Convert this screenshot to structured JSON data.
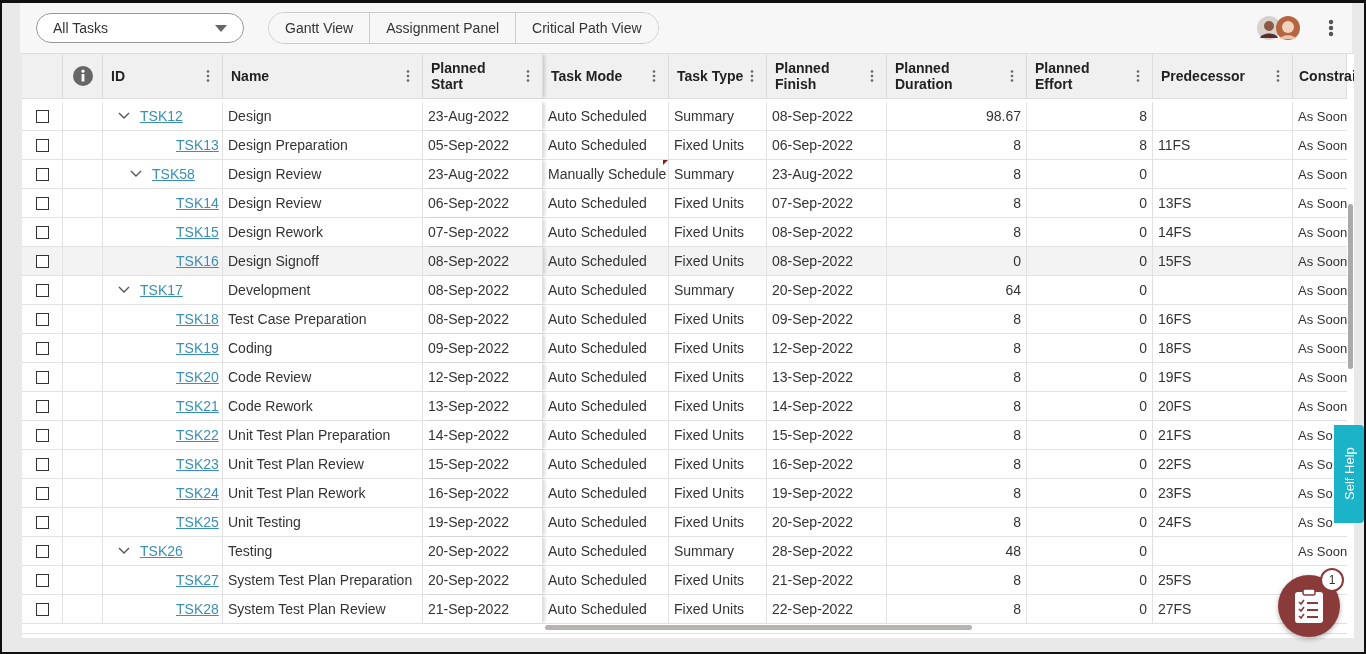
{
  "toolbar": {
    "filter": {
      "value": "All Tasks"
    },
    "views": [
      {
        "label": "Gantt View",
        "selected": false
      },
      {
        "label": "Assignment Panel",
        "selected": false
      },
      {
        "label": "Critical Path View",
        "selected": false
      }
    ]
  },
  "table": {
    "columns": [
      "ID",
      "Name",
      "Planned Start",
      "Task Mode",
      "Task Type",
      "Planned Finish",
      "Planned Duration",
      "Planned Effort",
      "Predecessor",
      "Constrai"
    ],
    "rows": [
      {
        "id": "TSK12",
        "name": "Design",
        "start": "23-Aug-2022",
        "mode": "Auto Scheduled",
        "type": "Summary",
        "finish": "08-Sep-2022",
        "duration": "98.67",
        "effort": "8",
        "constraint": "As Soon",
        "checked": false,
        "highlighted": false,
        "expanded": true,
        "children": [
          {
            "id": "TSK13",
            "name": "Design Preparation",
            "start": "05-Sep-2022",
            "mode": "Auto Scheduled",
            "type": "Fixed Units",
            "finish": "06-Sep-2022",
            "duration": "8",
            "effort": "8",
            "predecessor": "11FS",
            "constraint": "As Soon",
            "checked": false,
            "highlighted": false
          },
          {
            "id": "TSK58",
            "name": "Design Review",
            "start": "23-Aug-2022",
            "mode": "Manually Schedule",
            "type": "Summary",
            "finish": "23-Aug-2022",
            "duration": "8",
            "effort": "0",
            "constraint": "As Soon",
            "checked": false,
            "highlighted": false,
            "expanded": true,
            "flagged": true,
            "children": [
              {
                "id": "TSK14",
                "name": "Design Review",
                "start": "06-Sep-2022",
                "mode": "Auto Scheduled",
                "type": "Fixed Units",
                "finish": "07-Sep-2022",
                "duration": "8",
                "effort": "0",
                "predecessor": "13FS",
                "constraint": "As Soon",
                "checked": false,
                "highlighted": false
              },
              {
                "id": "TSK15",
                "name": "Design Rework",
                "start": "07-Sep-2022",
                "mode": "Auto Scheduled",
                "type": "Fixed Units",
                "finish": "08-Sep-2022",
                "duration": "8",
                "effort": "0",
                "predecessor": "14FS",
                "constraint": "As Soon",
                "checked": false,
                "highlighted": false
              },
              {
                "id": "TSK16",
                "name": "Design Signoff",
                "start": "08-Sep-2022",
                "mode": "Auto Scheduled",
                "type": "Fixed Units",
                "finish": "08-Sep-2022",
                "duration": "0",
                "effort": "0",
                "predecessor": "15FS",
                "constraint": "As Soon",
                "checked": false,
                "highlighted": true
              }
            ]
          }
        ]
      },
      {
        "id": "TSK17",
        "name": "Development",
        "start": "08-Sep-2022",
        "mode": "Auto Scheduled",
        "type": "Summary",
        "finish": "20-Sep-2022",
        "duration": "64",
        "effort": "0",
        "constraint": "As Soon",
        "checked": false,
        "highlighted": false,
        "expanded": true,
        "children": [
          {
            "id": "TSK18",
            "name": "Test Case Preparation",
            "start": "08-Sep-2022",
            "mode": "Auto Scheduled",
            "type": "Fixed Units",
            "finish": "09-Sep-2022",
            "duration": "8",
            "effort": "0",
            "predecessor": "16FS",
            "constraint": "As Soon",
            "checked": false,
            "highlighted": false
          },
          {
            "id": "TSK19",
            "name": "Coding",
            "start": "09-Sep-2022",
            "mode": "Auto Scheduled",
            "type": "Fixed Units",
            "finish": "12-Sep-2022",
            "duration": "8",
            "effort": "0",
            "predecessor": "18FS",
            "constraint": "As Soon",
            "checked": false,
            "highlighted": false
          },
          {
            "id": "TSK20",
            "name": "Code Review",
            "start": "12-Sep-2022",
            "mode": "Auto Scheduled",
            "type": "Fixed Units",
            "finish": "13-Sep-2022",
            "duration": "8",
            "effort": "0",
            "predecessor": "19FS",
            "constraint": "As Soon",
            "checked": false,
            "highlighted": false
          },
          {
            "id": "TSK21",
            "name": "Code Rework",
            "start": "13-Sep-2022",
            "mode": "Auto Scheduled",
            "type": "Fixed Units",
            "finish": "14-Sep-2022",
            "duration": "8",
            "effort": "0",
            "predecessor": "20FS",
            "constraint": "As Soon",
            "checked": false,
            "highlighted": false
          },
          {
            "id": "TSK22",
            "name": "Unit Test Plan Preparation",
            "start": "14-Sep-2022",
            "mode": "Auto Scheduled",
            "type": "Fixed Units",
            "finish": "15-Sep-2022",
            "duration": "8",
            "effort": "0",
            "predecessor": "21FS",
            "constraint": "As So",
            "checked": false,
            "highlighted": false
          },
          {
            "id": "TSK23",
            "name": "Unit Test Plan Review",
            "start": "15-Sep-2022",
            "mode": "Auto Scheduled",
            "type": "Fixed Units",
            "finish": "16-Sep-2022",
            "duration": "8",
            "effort": "0",
            "predecessor": "22FS",
            "constraint": "As So",
            "checked": false,
            "highlighted": false
          },
          {
            "id": "TSK24",
            "name": "Unit Test Plan Rework",
            "start": "16-Sep-2022",
            "mode": "Auto Scheduled",
            "type": "Fixed Units",
            "finish": "19-Sep-2022",
            "duration": "8",
            "effort": "0",
            "predecessor": "23FS",
            "constraint": "As So",
            "checked": false,
            "highlighted": false
          },
          {
            "id": "TSK25",
            "name": "Unit Testing",
            "start": "19-Sep-2022",
            "mode": "Auto Scheduled",
            "type": "Fixed Units",
            "finish": "20-Sep-2022",
            "duration": "8",
            "effort": "0",
            "predecessor": "24FS",
            "constraint": "As So",
            "checked": false,
            "highlighted": false
          }
        ]
      },
      {
        "id": "TSK26",
        "name": "Testing",
        "start": "20-Sep-2022",
        "mode": "Auto Scheduled",
        "type": "Summary",
        "finish": "28-Sep-2022",
        "duration": "48",
        "effort": "0",
        "constraint": "As Soon",
        "checked": false,
        "highlighted": false,
        "expanded": true,
        "children": [
          {
            "id": "TSK27",
            "name": "System Test Plan Preparation",
            "start": "20-Sep-2022",
            "mode": "Auto Scheduled",
            "type": "Fixed Units",
            "finish": "21-Sep-2022",
            "duration": "8",
            "effort": "0",
            "predecessor": "25FS",
            "checked": false,
            "highlighted": false
          },
          {
            "id": "TSK28",
            "name": "System Test Plan Review",
            "start": "21-Sep-2022",
            "mode": "Auto Scheduled",
            "type": "Fixed Units",
            "finish": "22-Sep-2022",
            "duration": "8",
            "effort": "0",
            "predecessor": "27FS",
            "checked": false,
            "highlighted": false
          }
        ]
      }
    ]
  },
  "self_help": {
    "label": "Self Help"
  },
  "tasks_button": {
    "badge": "1"
  }
}
